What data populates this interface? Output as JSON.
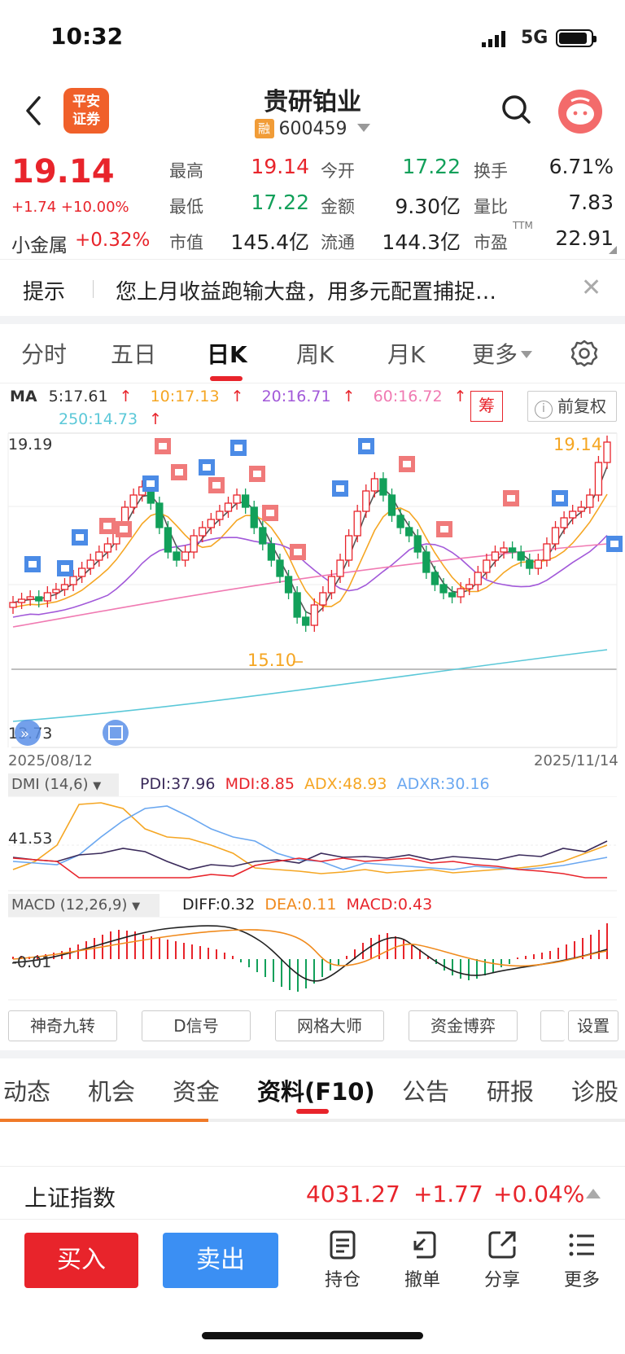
{
  "status": {
    "time": "10:32",
    "network": "5G"
  },
  "header": {
    "title": "贵研铂业",
    "code": "600459",
    "margin_badge": "融",
    "broker_logo": "平安\n证券",
    "broker_logo_top": "平安",
    "broker_logo_bottom": "证券"
  },
  "quote": {
    "price": "19.14",
    "change": "+1.74",
    "change_pct": "+10.00%",
    "sector_name": "小金属",
    "sector_change": "+0.32%",
    "high_label": "最高",
    "high": "19.14",
    "open_label": "今开",
    "open": "17.22",
    "turnover_label": "换手",
    "turnover": "6.71%",
    "low_label": "最低",
    "low": "17.22",
    "amount_label": "金额",
    "amount": "9.30亿",
    "vol_ratio_label": "量比",
    "vol_ratio": "7.83",
    "mktcap_label": "市值",
    "mktcap": "145.4亿",
    "float_label": "流通",
    "float_cap": "144.3亿",
    "pe_label": "市盈",
    "pe_sup": "TTM",
    "pe": "22.91"
  },
  "notice": {
    "label": "提示",
    "text": "您上月收益跑输大盘，用多元配置捕捉…"
  },
  "period_tabs": [
    "分时",
    "五日",
    "日K",
    "周K",
    "月K",
    "更多"
  ],
  "active_period": "日K",
  "ma_legend": {
    "name": "MA",
    "ma5": "5:17.61",
    "ma10": "10:17.13",
    "ma20": "20:16.71",
    "ma60": "60:16.72",
    "ma250": "250:14.73",
    "chou": "筹",
    "adjust": "前复权"
  },
  "kchart": {
    "high_label": "19.19",
    "low_label": "13.73",
    "last_label": "19.14",
    "min_label": "15.10",
    "start_date": "2025/08/12",
    "end_date": "2025/11/14"
  },
  "dmi": {
    "title": "DMI (14,6)",
    "pdi": "PDI:37.96",
    "mdi": "MDI:8.85",
    "adx": "ADX:48.93",
    "adxr": "ADXR:30.16",
    "level": "41.53"
  },
  "macd": {
    "title": "MACD (12,26,9)",
    "diff": "DIFF:0.32",
    "dea": "DEA:0.11",
    "macd": "MACD:0.43",
    "level": "-0.01"
  },
  "indicator_buttons": [
    "神奇九转",
    "D信号",
    "网格大师",
    "资金博弈",
    "设置"
  ],
  "bottom_tabs": [
    "动态",
    "机会",
    "资金",
    "资料(F10)",
    "公告",
    "研报",
    "诊股"
  ],
  "active_bottom_tab": "资料(F10)",
  "index": {
    "name": "上证指数",
    "value": "4031.27",
    "change": "+1.77",
    "pct": "+0.04%"
  },
  "actions": {
    "buy": "买入",
    "sell": "卖出",
    "position": "持仓",
    "cancel": "撤单",
    "share": "分享",
    "more": "更多"
  },
  "colors": {
    "up": "#e8242b",
    "down": "#12a05a",
    "accent": "#f07a28",
    "sell_blue": "#3b8ff3"
  }
}
